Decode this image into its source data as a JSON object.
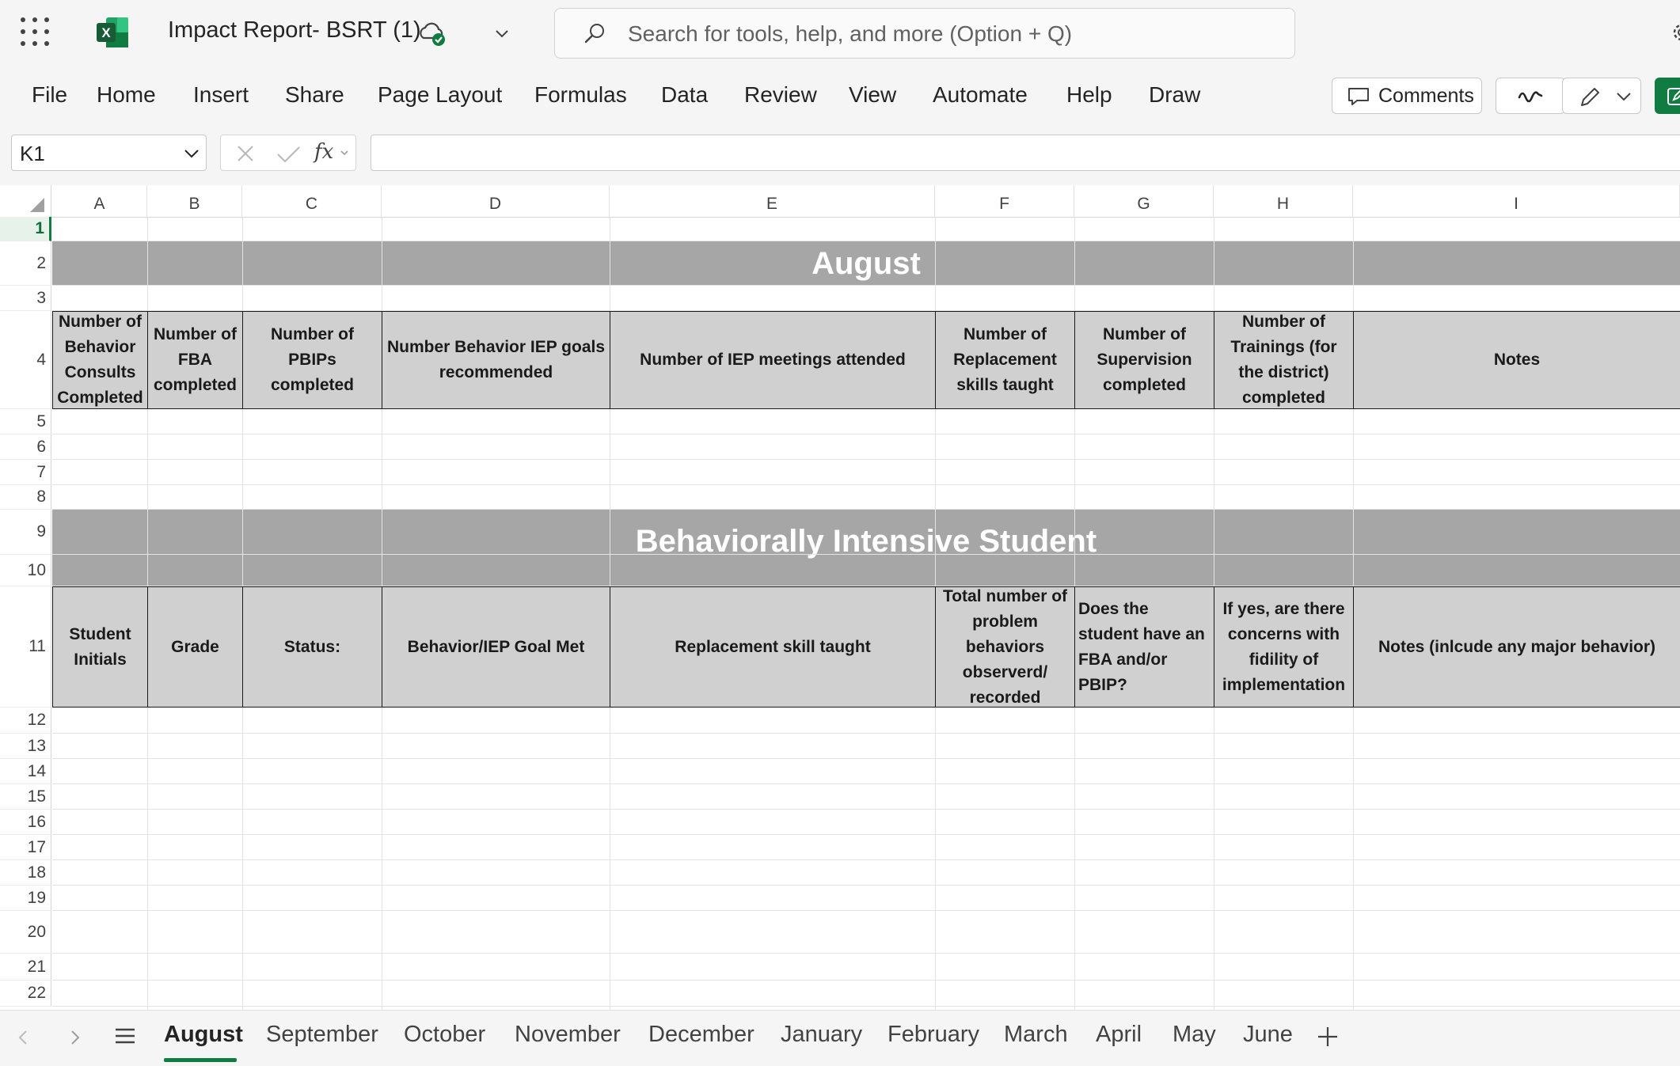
{
  "app": {
    "doc_title": "Impact Report- BSRT (1)",
    "search_placeholder": "Search for tools, help, and more (Option + Q)",
    "brand_color": "#107c41"
  },
  "menu": {
    "items": [
      "File",
      "Home",
      "Insert",
      "Share",
      "Page Layout",
      "Formulas",
      "Data",
      "Review",
      "View",
      "Automate",
      "Help",
      "Draw"
    ],
    "comments_label": "Comments"
  },
  "formula_bar": {
    "name_box": "K1",
    "fx_symbol": "fx",
    "formula_value": ""
  },
  "grid": {
    "columns": [
      "A",
      "B",
      "C",
      "D",
      "E",
      "F",
      "G",
      "H",
      "I"
    ],
    "rows": [
      "1",
      "2",
      "3",
      "4",
      "5",
      "6",
      "7",
      "8",
      "9",
      "10",
      "11",
      "12",
      "13",
      "14",
      "15",
      "16",
      "17",
      "18",
      "19",
      "20",
      "21",
      "22"
    ],
    "selected_row": "1",
    "banner_1": "August",
    "banner_2": "Behaviorally Intensive Student",
    "header_row_4": [
      "Number of Behavior Consults Completed",
      "Number of FBA completed",
      "Number of PBIPs completed",
      "Number Behavior IEP goals recommended",
      "Number of IEP meetings attended",
      "Number of Replacement skills taught",
      "Number of Supervision completed",
      "Number of Trainings (for the district) completed",
      "Notes"
    ],
    "header_row_11": [
      "Student Initials",
      "Grade",
      "Status:",
      "Behavior/IEP Goal Met",
      "Replacement skill taught",
      "Total number of problem behaviors observerd/ recorded",
      "Does the student have an FBA and/or PBIP?",
      "If yes, are there concerns with fidility of implementation",
      "Notes  (inlcude any major behavior)"
    ],
    "header_fill_color": "#d0d0d0",
    "banner_fill_color": "#a6a6a6"
  },
  "sheets": {
    "tabs": [
      "August",
      "September",
      "October",
      "November",
      "December",
      "January",
      "February",
      "March",
      "April",
      "May",
      "June"
    ],
    "active": "August"
  }
}
